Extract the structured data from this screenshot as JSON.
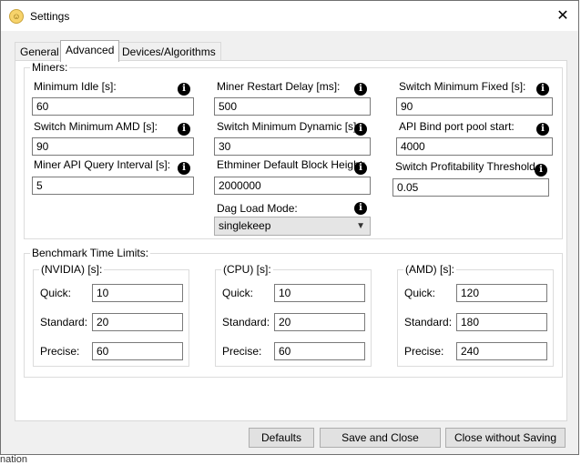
{
  "window": {
    "title": "Settings",
    "close_glyph": "✕"
  },
  "tabs": [
    {
      "label": "General",
      "active": false
    },
    {
      "label": "Advanced",
      "active": true
    },
    {
      "label": "Devices/Algorithms",
      "active": false
    }
  ],
  "miners": {
    "legend": "Miners:",
    "fields": {
      "minimum_idle": {
        "label": "Minimum Idle [s]:",
        "value": "60"
      },
      "miner_restart_delay": {
        "label": "Miner Restart Delay [ms]:",
        "value": "500"
      },
      "switch_minimum_fixed": {
        "label": "Switch Minimum Fixed [s]:",
        "value": "90"
      },
      "switch_minimum_amd": {
        "label": "Switch Minimum AMD [s]:",
        "value": "90"
      },
      "switch_minimum_dynamic": {
        "label": "Switch Minimum Dynamic [s]:",
        "value": "30"
      },
      "api_bind_port_pool_start": {
        "label": "API Bind port pool start:",
        "value": "4000"
      },
      "miner_api_query_interval": {
        "label": "Miner API Query Interval [s]:",
        "value": "5"
      },
      "ethminer_default_block_height": {
        "label": "Ethminer Default Block Height:",
        "value": "2000000"
      },
      "switch_profitability_threshold": {
        "label": "Switch Profitability Threshold",
        "value": "0.05"
      },
      "dag_load_mode": {
        "label": "Dag Load Mode:",
        "value": "singlekeep"
      }
    }
  },
  "benchmark": {
    "legend": "Benchmark Time Limits:",
    "groups": {
      "nvidia": {
        "legend": "(NVIDIA) [s]:",
        "quick": "10",
        "standard": "20",
        "precise": "60"
      },
      "cpu": {
        "legend": "(CPU) [s]:",
        "quick": "10",
        "standard": "20",
        "precise": "60"
      },
      "amd": {
        "legend": "(AMD) [s]:",
        "quick": "120",
        "standard": "180",
        "precise": "240"
      }
    },
    "row_labels": {
      "quick": "Quick:",
      "standard": "Standard:",
      "precise": "Precise:"
    }
  },
  "buttons": {
    "defaults": "Defaults",
    "save_and_close": "Save and Close",
    "close_without_saving": "Close without Saving"
  },
  "background_text": "nation",
  "icons": {
    "info": "info-icon",
    "app": "app-icon",
    "dropdown": "chevron-down-icon"
  },
  "colors": {
    "window_bg": "#f0f0f0",
    "panel_bg": "#ffffff",
    "button_bg": "#e1e1e1",
    "border": "#adadad"
  }
}
